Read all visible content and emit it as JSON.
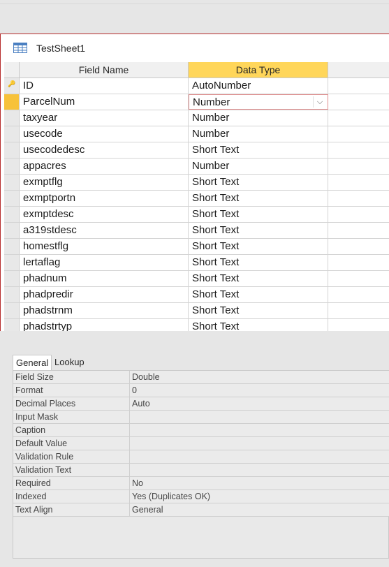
{
  "window": {
    "tab_title": "TestSheet1"
  },
  "grid": {
    "headers": {
      "field_name": "Field Name",
      "data_type": "Data Type"
    },
    "rows": [
      {
        "name": "ID",
        "type": "AutoNumber"
      },
      {
        "name": "ParcelNum",
        "type": "Number"
      },
      {
        "name": "taxyear",
        "type": "Number"
      },
      {
        "name": "usecode",
        "type": "Number"
      },
      {
        "name": "usecodedesc",
        "type": "Short Text"
      },
      {
        "name": "appacres",
        "type": "Number"
      },
      {
        "name": "exmptflg",
        "type": "Short Text"
      },
      {
        "name": "exmptportn",
        "type": "Short Text"
      },
      {
        "name": "exmptdesc",
        "type": "Short Text"
      },
      {
        "name": "a319stdesc",
        "type": "Short Text"
      },
      {
        "name": "homestflg",
        "type": "Short Text"
      },
      {
        "name": "lertaflag",
        "type": "Short Text"
      },
      {
        "name": "phadnum",
        "type": "Short Text"
      },
      {
        "name": "phadpredir",
        "type": "Short Text"
      },
      {
        "name": "phadstrnm",
        "type": "Short Text"
      },
      {
        "name": "phadstrtyp",
        "type": "Short Text"
      }
    ]
  },
  "properties": {
    "tabs": {
      "general": "General",
      "lookup": "Lookup"
    },
    "rows": [
      {
        "label": "Field Size",
        "value": "Double"
      },
      {
        "label": "Format",
        "value": "0"
      },
      {
        "label": "Decimal Places",
        "value": "Auto"
      },
      {
        "label": "Input Mask",
        "value": ""
      },
      {
        "label": "Caption",
        "value": ""
      },
      {
        "label": "Default Value",
        "value": ""
      },
      {
        "label": "Validation Rule",
        "value": ""
      },
      {
        "label": "Validation Text",
        "value": ""
      },
      {
        "label": "Required",
        "value": "No"
      },
      {
        "label": "Indexed",
        "value": "Yes (Duplicates OK)"
      },
      {
        "label": "Text Align",
        "value": "General"
      }
    ]
  },
  "colors": {
    "accent_header": "#ffd65a",
    "current_row": "#f7c23a",
    "frame": "#b62b2b"
  }
}
